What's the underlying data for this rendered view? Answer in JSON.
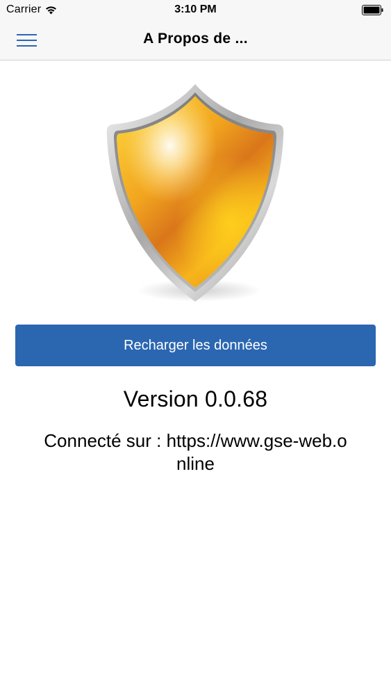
{
  "status_bar": {
    "carrier": "Carrier",
    "time": "3:10 PM",
    "icons": [
      "wifi-icon",
      "battery-icon"
    ]
  },
  "nav_bar": {
    "title": "A Propos de ...",
    "menu_icon": "hamburger-menu-icon",
    "accent_color": "#2b66b1"
  },
  "content": {
    "logo_icon": "shield-icon",
    "reload_button_label": "Recharger les données",
    "version": "Version 0.0.68",
    "connection": "Connecté sur : https://www.gse-web.online"
  }
}
